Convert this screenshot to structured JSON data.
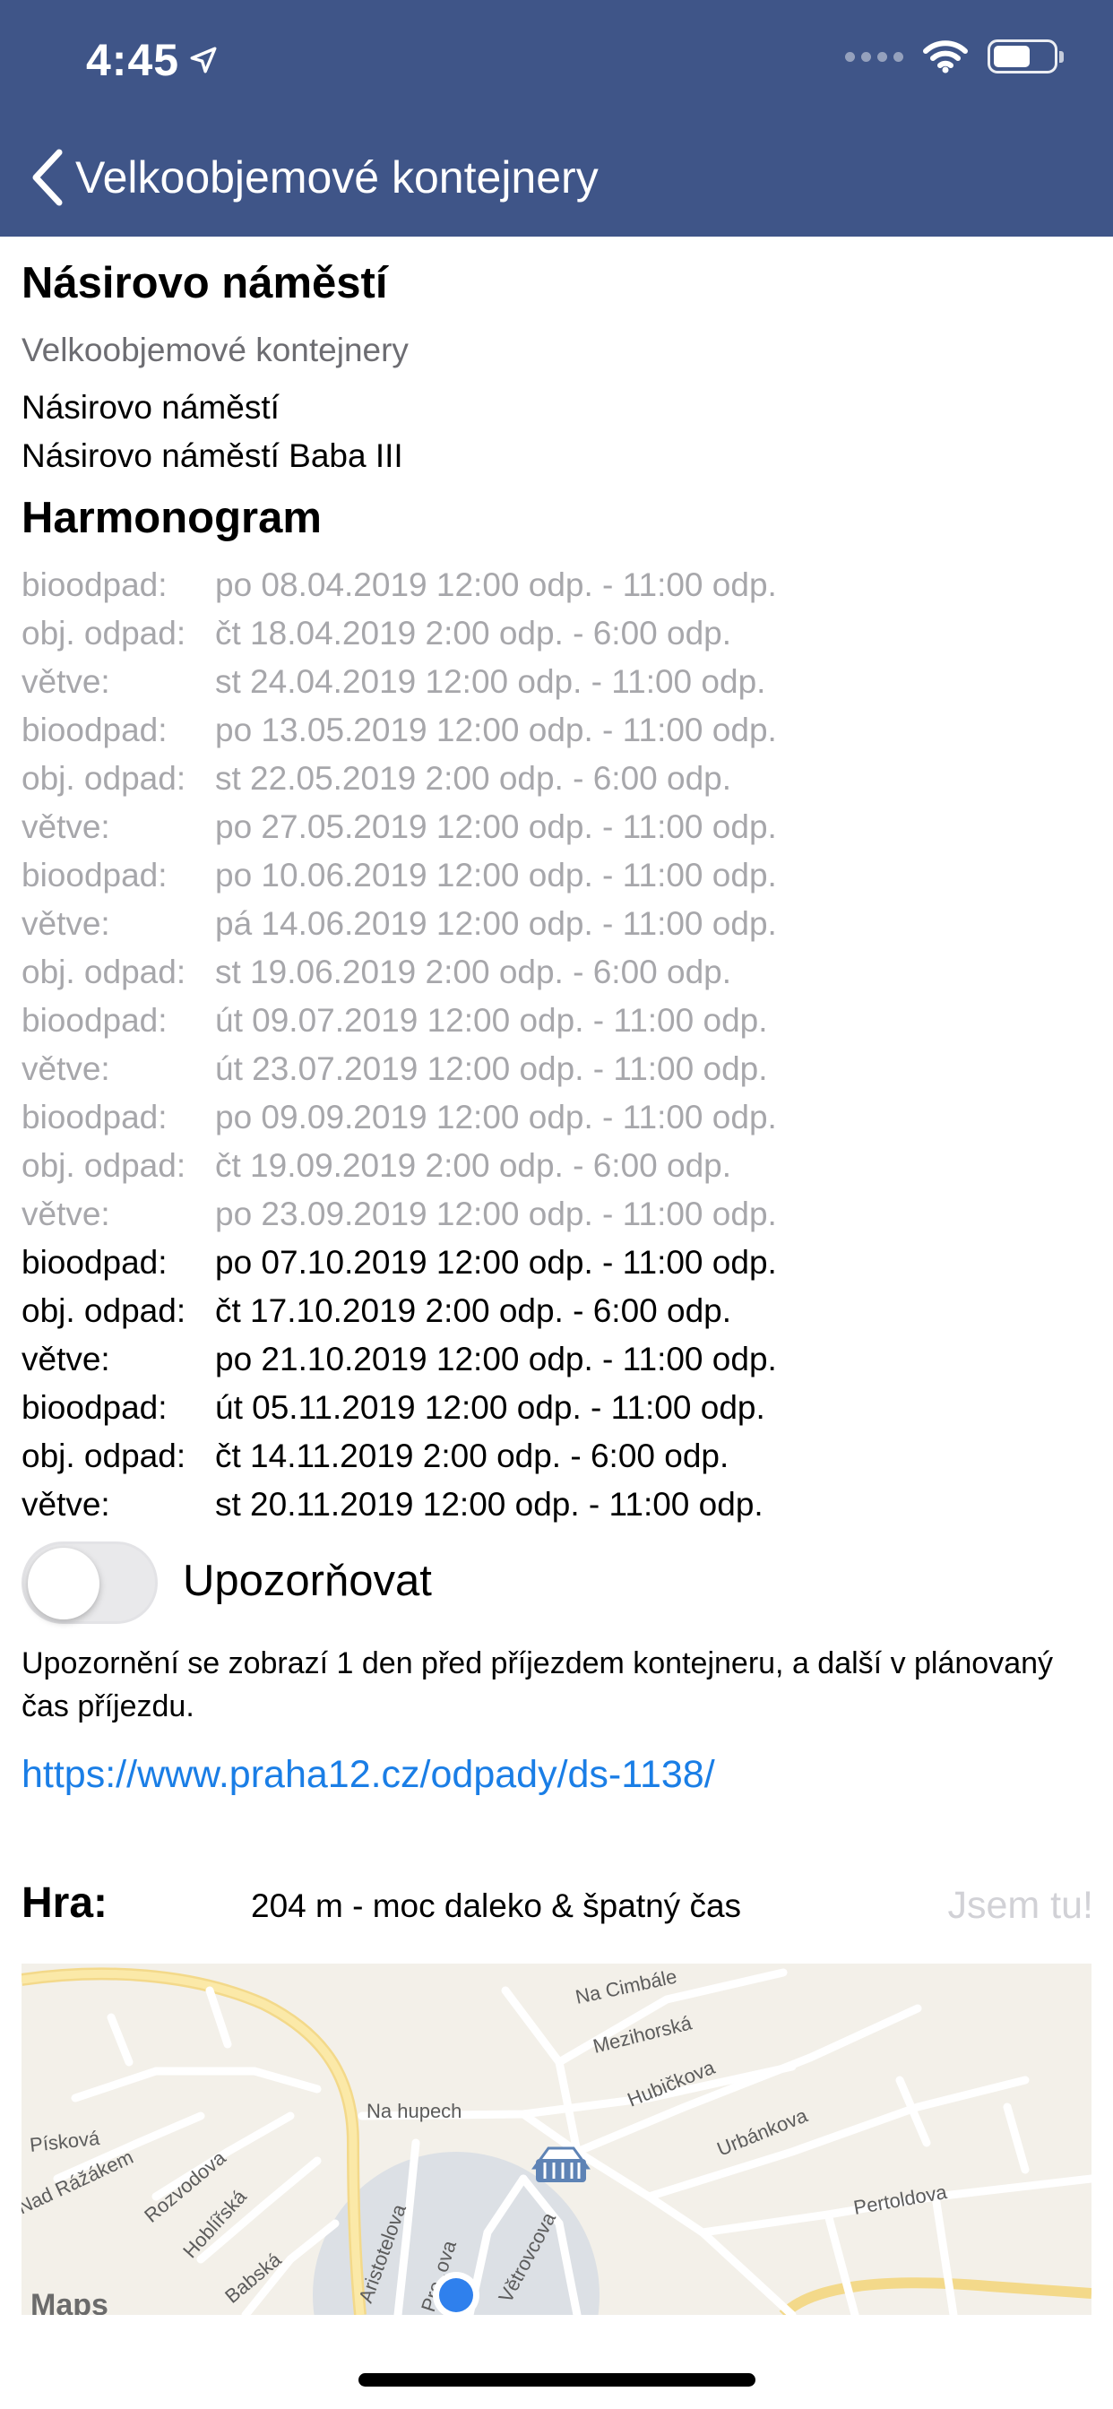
{
  "status_bar": {
    "time": "4:45",
    "location_icon": "location-arrow-icon",
    "signal_icon": "signal-dots-icon",
    "wifi_icon": "wifi-icon",
    "battery_icon": "battery-icon",
    "battery_level": 0.62
  },
  "nav": {
    "back_icon": "chevron-left-icon",
    "back_label": "Velkoobjemové kontejnery",
    "bar_color": "#3f5588"
  },
  "place": {
    "title": "Násirovo náměstí",
    "subtitle": "Velkoobjemové kontejnery",
    "address_line1": "Násirovo náměstí",
    "address_line2": "Násirovo náměstí Baba III"
  },
  "harmonogram": {
    "title": "Harmonogram",
    "rows": [
      {
        "type": "bioodpad:",
        "when": "po 08.04.2019 12:00 odp. - 11:00 odp.",
        "past": true
      },
      {
        "type": "obj. odpad:",
        "when": "čt 18.04.2019 2:00 odp. - 6:00 odp.",
        "past": true
      },
      {
        "type": "větve:",
        "when": "st 24.04.2019 12:00 odp. - 11:00 odp.",
        "past": true
      },
      {
        "type": "bioodpad:",
        "when": "po 13.05.2019 12:00 odp. - 11:00 odp.",
        "past": true
      },
      {
        "type": "obj. odpad:",
        "when": "st 22.05.2019 2:00 odp. - 6:00 odp.",
        "past": true
      },
      {
        "type": "větve:",
        "when": "po 27.05.2019 12:00 odp. - 11:00 odp.",
        "past": true
      },
      {
        "type": "bioodpad:",
        "when": "po 10.06.2019 12:00 odp. - 11:00 odp.",
        "past": true
      },
      {
        "type": "větve:",
        "when": "pá 14.06.2019 12:00 odp. - 11:00 odp.",
        "past": true
      },
      {
        "type": "obj. odpad:",
        "when": "st 19.06.2019 2:00 odp. - 6:00 odp.",
        "past": true
      },
      {
        "type": "bioodpad:",
        "when": "út 09.07.2019 12:00 odp. - 11:00 odp.",
        "past": true
      },
      {
        "type": "větve:",
        "when": "út 23.07.2019 12:00 odp. - 11:00 odp.",
        "past": true
      },
      {
        "type": "bioodpad:",
        "when": "po 09.09.2019 12:00 odp. - 11:00 odp.",
        "past": true
      },
      {
        "type": "obj. odpad:",
        "when": "čt 19.09.2019 2:00 odp. - 6:00 odp.",
        "past": true
      },
      {
        "type": "větve:",
        "when": "po 23.09.2019 12:00 odp. - 11:00 odp.",
        "past": true
      },
      {
        "type": "bioodpad:",
        "when": "po 07.10.2019 12:00 odp. - 11:00 odp.",
        "past": false
      },
      {
        "type": "obj. odpad:",
        "when": "čt 17.10.2019 2:00 odp. - 6:00 odp.",
        "past": false
      },
      {
        "type": "větve:",
        "when": "po 21.10.2019 12:00 odp. - 11:00 odp.",
        "past": false
      },
      {
        "type": "bioodpad:",
        "when": "út 05.11.2019 12:00 odp. - 11:00 odp.",
        "past": false
      },
      {
        "type": "obj. odpad:",
        "when": "čt 14.11.2019 2:00 odp. - 6:00 odp.",
        "past": false
      },
      {
        "type": "větve:",
        "when": "st 20.11.2019 12:00 odp. - 11:00 odp.",
        "past": false
      }
    ]
  },
  "notify": {
    "label": "Upozorňovat",
    "enabled": false,
    "description": "Upozornění se zobrazí 1 den před příjezdem kontejneru, a další v plánovaný čas příjezdu."
  },
  "link": {
    "text": "https://www.praha12.cz/odpady/ds-1138/"
  },
  "game": {
    "label": "Hra:",
    "status": "204 m - moc daleko & špatný čas",
    "button": "Jsem tu!"
  },
  "map": {
    "streets": [
      "Na Cimbále",
      "Mezihorská",
      "Hubičkova",
      "Urbánkova",
      "Pertoldova",
      "Na hupech",
      "Písková",
      "Nad Rážákem",
      "Rozvodova",
      "Hoblířská",
      "Babská",
      "Aristotelova",
      "Větrovcova",
      "Pro..ova"
    ],
    "attribution": "Maps",
    "container_icon": "container-pin-icon",
    "user_location_icon": "user-location-icon",
    "user_dot_color": "#2f80ed"
  }
}
